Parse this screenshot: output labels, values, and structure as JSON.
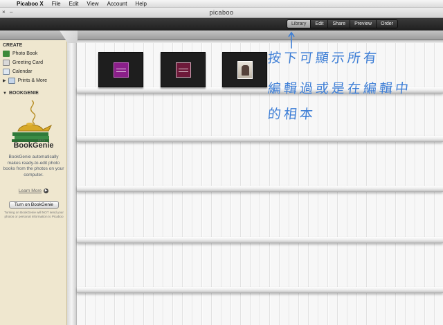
{
  "menubar": {
    "apple_icon": "apple-icon",
    "items": [
      "Picaboo X",
      "File",
      "Edit",
      "View",
      "Account",
      "Help"
    ]
  },
  "window": {
    "title": "picaboo",
    "close_glyph": "×",
    "min_glyph": "–"
  },
  "toolbar": {
    "tabs": [
      "Library",
      "Edit",
      "Share",
      "Preview",
      "Order"
    ],
    "active_tab": "Library"
  },
  "sidebar": {
    "create_header": "CREATE",
    "create_items": [
      {
        "label": "Photo Book",
        "icon": "photo-book-icon"
      },
      {
        "label": "Greeting Card",
        "icon": "greeting-card-icon"
      },
      {
        "label": "Calendar",
        "icon": "calendar-icon"
      },
      {
        "label": "Prints & More",
        "icon": "prints-icon"
      }
    ],
    "bookgenie_header": "BOOKGENIE",
    "bookgenie": {
      "beta": "BETA",
      "title": "BookGenie",
      "description": "BookGenie automatically makes ready-to-edit photo books from the photos on your computer.",
      "learn_more": "Learn More",
      "button": "Turn on BookGenie",
      "note": "Turning on BookGenie will NOT send your photos or personal information to Picaboo"
    }
  },
  "library": {
    "books": [
      {
        "name": "book-1",
        "cover_color": "#8b1f8a"
      },
      {
        "name": "book-2",
        "cover_color": "#6e1a3a"
      },
      {
        "name": "book-3",
        "cover_color": "#d8d2c6"
      }
    ]
  },
  "annotation": {
    "color": "#3d7ed6",
    "lines": [
      "按下可顯示所有",
      "編輯過或是在編輯中",
      "的相本"
    ]
  }
}
